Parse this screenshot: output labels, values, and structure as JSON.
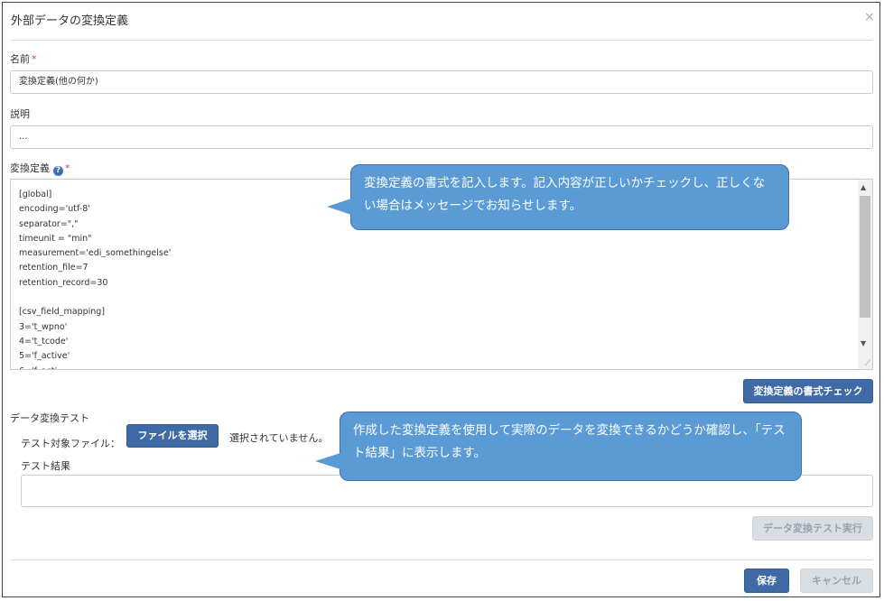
{
  "dialog": {
    "title": "外部データの変換定義",
    "close_glyph": "×"
  },
  "form": {
    "name_label": "名前",
    "required_mark": "*",
    "name_value": "変換定義(他の何か)",
    "description_label": "説明",
    "description_value": "...",
    "definition_label": "変換定義",
    "help_glyph": "?",
    "definition_lines": [
      "[global]",
      "encoding='utf-8'",
      "separator=\",\"",
      "timeunit = \"min\"",
      "measurement='edi_somethingelse'",
      "retention_file=7",
      "retention_record=30",
      "",
      "[csv_field_mapping]",
      "3='t_wpno'",
      "4='t_tcode'",
      "5='f_active'",
      "6='f_acti"
    ],
    "format_check_button": "変換定義の書式チェック"
  },
  "test": {
    "section_label": "データ変換テスト",
    "file_label": "テスト対象ファイル：",
    "file_button": "ファイルを選択",
    "file_status": "選択されていません。",
    "result_label": "テスト結果",
    "result_value": "",
    "run_button": "データ変換テスト実行"
  },
  "footer": {
    "save_button": "保存",
    "cancel_button": "キャンセル"
  },
  "callouts": {
    "definition": "変換定義の書式を記入します。記入内容が正しいかチェックし、正しくない場合はメッセージでお知らせします。",
    "test": "作成した変換定義を使用して実際のデータを変換できるかどうか確認し、「テスト結果」に表示します。"
  },
  "colors": {
    "primary": "#3f6aa6",
    "callout": "#5b9bd5",
    "required": "#e04040"
  }
}
